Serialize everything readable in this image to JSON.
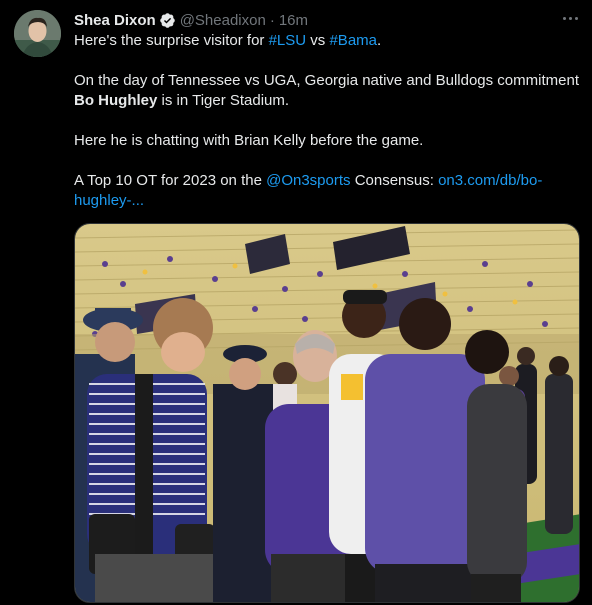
{
  "author": {
    "display_name": "Shea Dixon",
    "handle": "@Sheadixon",
    "separator": "·",
    "time": "16m",
    "verified": true
  },
  "tweet": {
    "line1": {
      "prefix": "Here's the surprise visitor for ",
      "tag1": "#LSU",
      "middle": " vs ",
      "tag2": "#Bama",
      "suffix": "."
    },
    "para2": {
      "line1": "On the day of Tennessee vs UGA, Georgia native and Bulldogs commitment",
      "name_bold": "Bo Hughley",
      "line2_rest": " is in Tiger Stadium."
    },
    "para3": "Here he is chatting with Brian Kelly before the game.",
    "para4": {
      "prefix": "A Top 10 OT for 2023 on the ",
      "mention": "@On3sports",
      "middle": " Consensus: ",
      "link_part1": "on3.com/db/bo-",
      "link_part2": "hughley-..."
    }
  },
  "icons": {
    "verified": "verified-badge-icon",
    "more": "more-options-icon"
  },
  "colors": {
    "background": "#000000",
    "text": "#e7e9ea",
    "secondary": "#71767b",
    "link": "#1d9bf0",
    "lsu_purple": "#4b3695",
    "lsu_gold": "#f5b400"
  }
}
